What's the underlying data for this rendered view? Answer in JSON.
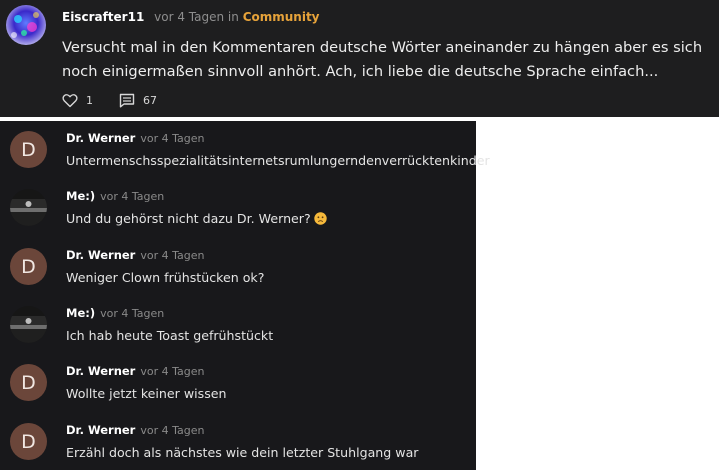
{
  "post": {
    "author": "Eiscrafter11",
    "time": "vor 4 Tagen",
    "in_word": "in",
    "community": "Community",
    "text": "Versucht mal in den Kommentaren deutsche Wörter aneinander zu hängen aber es sich noch einigermaßen sinnvoll anhört. Ach, ich liebe die deutsche Sprache einfach...",
    "likes": "1",
    "comments": "67",
    "icons": {
      "like": "heart-icon",
      "comment": "comment-icon"
    },
    "colors": {
      "background": "#1e1e1f",
      "community": "#e7a33a"
    }
  },
  "comments": [
    {
      "author": "Dr. Werner",
      "time": "vor 4 Tagen",
      "text": "Untermenschsspezialitätsinternetsrumlungerndenverrücktenkinder",
      "avatar_letter": "D"
    },
    {
      "author": "Me:)",
      "time": "vor 4 Tagen",
      "text": "Und du gehörst nicht dazu Dr. Werner?",
      "emoji": "worried-face-emoji"
    },
    {
      "author": "Dr. Werner",
      "time": "vor 4 Tagen",
      "text": "Weniger Clown frühstücken ok?",
      "avatar_letter": "D"
    },
    {
      "author": "Me:)",
      "time": "vor 4 Tagen",
      "text": "Ich hab heute Toast gefrühstückt"
    },
    {
      "author": "Dr. Werner",
      "time": "vor 4 Tagen",
      "text": "Wollte jetzt keiner wissen",
      "avatar_letter": "D"
    },
    {
      "author": "Dr. Werner",
      "time": "vor 4 Tagen",
      "text": "Erzähl doch als nächstes wie dein letzter Stuhlgang war",
      "avatar_letter": "D"
    }
  ],
  "colors": {
    "comments_background": "#18181b",
    "letter_avatar": "#6b463a"
  }
}
